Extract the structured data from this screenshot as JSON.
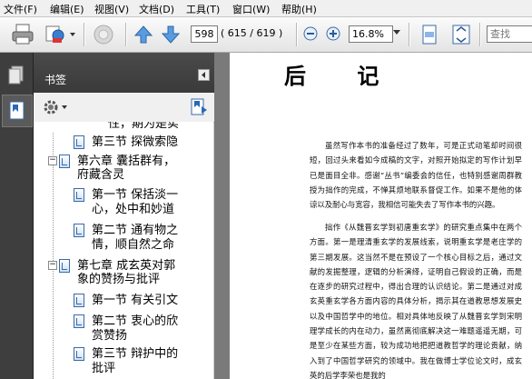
{
  "menu": {
    "file": "文件(F)",
    "edit": "编辑(E)",
    "view": "视图(V)",
    "document": "文档(D)",
    "tools": "工具(T)",
    "window": "窗口(W)",
    "help": "帮助(H)"
  },
  "toolbar": {
    "page_number": "598",
    "page_count": "( 615 / 619 )",
    "zoom": "16.8%",
    "search_placeholder": "查找"
  },
  "bookmarks": {
    "title": "书签",
    "items": [
      {
        "text1": "性，期为是实",
        "text2": ""
      },
      {
        "text1": "第三节 探微索隐",
        "text2": ""
      },
      {
        "text1": "第六章 囊括群有，",
        "text2": "府藏含灵"
      },
      {
        "text1": "第一节 保括淡一",
        "text2": "心，处中和妙道"
      },
      {
        "text1": "第二节 通有物之",
        "text2": "情，顺自然之命"
      },
      {
        "text1": "第七章 成玄英对郭",
        "text2": "象的赞扬与批评"
      },
      {
        "text1": "第一节 有关引文",
        "text2": ""
      },
      {
        "text1": "第二节 衷心的欣",
        "text2": "赏赞扬"
      },
      {
        "text1": "第三节 辩护中的",
        "text2": "批评"
      }
    ]
  },
  "document": {
    "title": "后 记",
    "paragraphs": [
      "虽然写作本书的准备经过了数年，可是正式动笔却时间很短，回过头来看如今成稿的文字，对照开始拟定的写作计划早已是面目全非。感谢“丛书”编委会的信任，也特别感谢周群教授为拙作的完成，不惮其烦地联系督促工作。如果不是他的体谅以及耐心与宽容，我相信可能失去了写作本书的兴趣。",
      "拙作《从魏晋玄学到初唐重玄学》的研究重点集中在两个方面。第一是理清重玄学的发展线索，说明重玄学是老庄学的第三期发展。这当然不是在预设了一个核心目标之后，通过文献的发掘整理，逻辑的分析演绎，证明自己假设的正确，而是在逐步的研究过程中，得出合理的认识结论。第二是通过对成玄英重玄学各方面内容的具体分析，揭示其在道教思想发展史以及中国哲学中的地位。相对具体地反映了从魏晋玄学到宋明理学成长的内在动力，虽然离彻底解决这一难题遥遥无期，可是至少在某些方面，较为成功地把把道教哲学的理论贡献，纳入到了中国哲学研究的领域中。我在做博士学位论文时，成玄英的后学李荣也是我的"
    ]
  }
}
